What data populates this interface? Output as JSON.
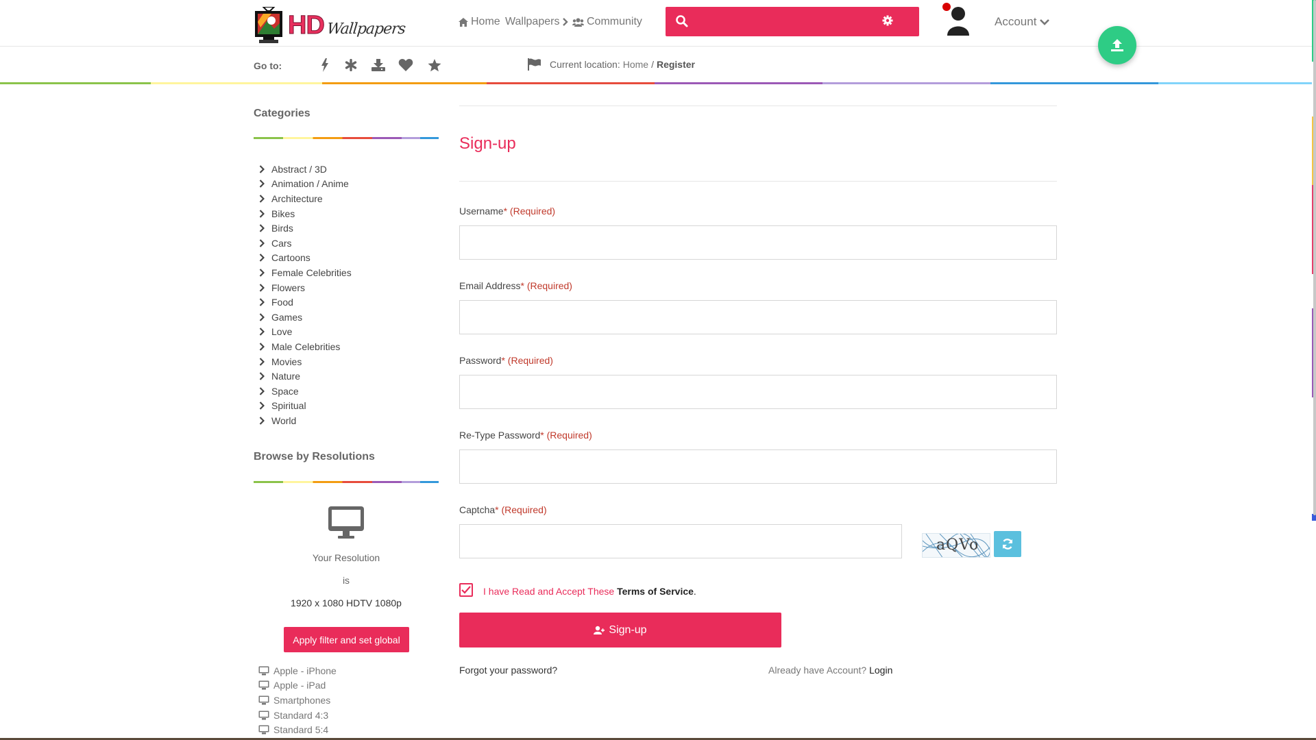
{
  "header": {
    "logo": {
      "hd": "HD",
      "script": "Wallpapers"
    },
    "nav": {
      "home": "Home",
      "wallpapers": "Wallpapers",
      "community": "Community"
    },
    "search": {
      "placeholder": ""
    },
    "account_label": "Account"
  },
  "subbar": {
    "goto_label": "Go to:",
    "quick_icons": [
      "bolt-icon",
      "asterisk-icon",
      "download-icon",
      "heart-icon",
      "star-icon"
    ],
    "location_label": "Current location:",
    "breadcrumb": {
      "home": "Home",
      "separator": "/",
      "current": "Register"
    }
  },
  "sidebar": {
    "categories_title": "Categories",
    "categories": [
      "Abstract / 3D",
      "Animation / Anime",
      "Architecture",
      "Bikes",
      "Birds",
      "Cars",
      "Cartoons",
      "Female Celebrities",
      "Flowers",
      "Food",
      "Games",
      "Love",
      "Male Celebrities",
      "Movies",
      "Nature",
      "Space",
      "Spiritual",
      "World"
    ],
    "resolutions_title": "Browse by Resolutions",
    "your_resolution": "Your Resolution",
    "is_label": "is",
    "resolution_value": "1920 x 1080 HDTV 1080p",
    "apply_button": "Apply filter and set global",
    "devices": [
      "Apple - iPhone",
      "Apple - iPad",
      "Smartphones",
      "Standard 4:3",
      "Standard 5:4"
    ]
  },
  "form": {
    "title": "Sign-up",
    "required_marker": "* (Required)",
    "username_label": "Username",
    "email_label": "Email Address",
    "password_label": "Password",
    "retype_label": "Re-Type Password",
    "captcha_label": "Captcha",
    "captcha_text": "aQVo",
    "tos_text": "I have Read and Accept These",
    "tos_link": "Terms of Service",
    "tos_end": ".",
    "tos_checked": true,
    "signup_button": "Sign-up",
    "forgot_password": "Forgot your password?",
    "have_account": "Already have Account?",
    "login_link": "Login"
  },
  "colors": {
    "accent": "#e92c5a",
    "fab": "#2ecc85",
    "refresh": "#5bc0de"
  }
}
